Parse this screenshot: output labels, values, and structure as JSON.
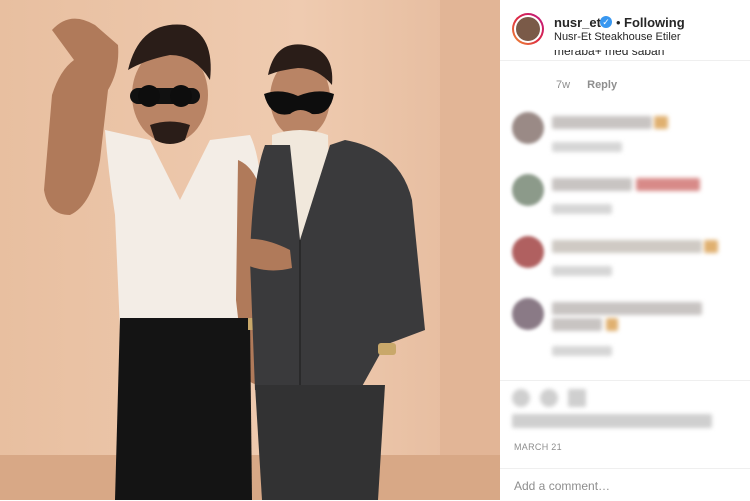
{
  "post": {
    "username": "nusr_et",
    "follow_status": "Following",
    "dot": "•",
    "location": "Nusr-Et Steakhouse Etiler",
    "verified_glyph": "✓"
  },
  "previous_comment": {
    "text": "meraba+ med sabah"
  },
  "meta": {
    "time": "7w",
    "reply_label": "Reply"
  },
  "date": "MARCH 21",
  "add_comment_placeholder": "Add a comment…",
  "icons": [
    "verified-badge-icon",
    "avatar-icon"
  ],
  "colors": {
    "accent": "#3897f0",
    "wall": "#eac3a6",
    "muted": "#8e8e8e"
  }
}
